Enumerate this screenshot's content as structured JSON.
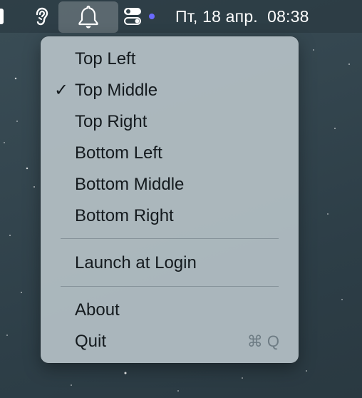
{
  "menubar": {
    "icons": [
      "ear-icon",
      "bell-icon",
      "toggle-switch-icon",
      "status-dot"
    ],
    "clock": "Пт, 18 апр.  08:38",
    "accent_dot_color": "#6b6bff"
  },
  "menu": {
    "position_items": [
      {
        "label": "Top Left",
        "checked": false
      },
      {
        "label": "Top Middle",
        "checked": true
      },
      {
        "label": "Top Right",
        "checked": false
      },
      {
        "label": "Bottom Left",
        "checked": false
      },
      {
        "label": "Bottom Middle",
        "checked": false
      },
      {
        "label": "Bottom Right",
        "checked": false
      }
    ],
    "check_mark": "✓",
    "launch_at_login": {
      "label": "Launch at Login",
      "checked": false
    },
    "about": {
      "label": "About"
    },
    "quit": {
      "label": "Quit",
      "shortcut": "⌘ Q"
    }
  }
}
